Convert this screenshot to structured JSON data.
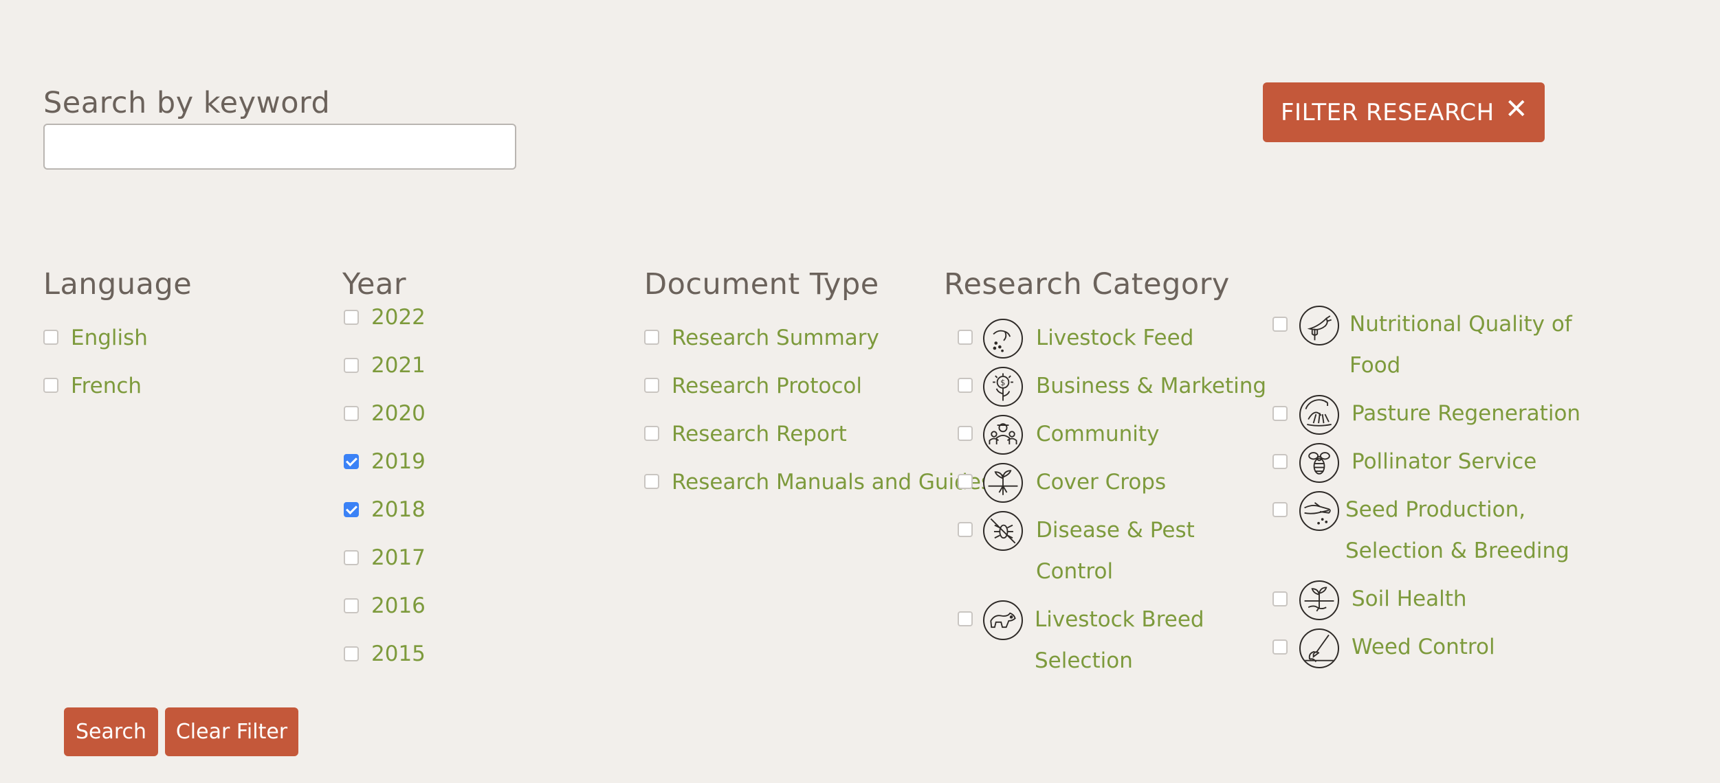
{
  "search": {
    "label": "Search by keyword",
    "value": "",
    "placeholder": ""
  },
  "filter_button": {
    "label": "FILTER RESEARCH",
    "close_symbol": "✕"
  },
  "language": {
    "heading": "Language",
    "options": [
      {
        "label": "English",
        "checked": false
      },
      {
        "label": "French",
        "checked": false
      }
    ]
  },
  "year": {
    "heading": "Year",
    "options": [
      {
        "label": "2022",
        "checked": false
      },
      {
        "label": "2021",
        "checked": false
      },
      {
        "label": "2020",
        "checked": false
      },
      {
        "label": "2019",
        "checked": true
      },
      {
        "label": "2018",
        "checked": true
      },
      {
        "label": "2017",
        "checked": false
      },
      {
        "label": "2016",
        "checked": false
      },
      {
        "label": "2015",
        "checked": false
      }
    ]
  },
  "document_type": {
    "heading": "Document Type",
    "options": [
      {
        "label": "Research Summary",
        "checked": false
      },
      {
        "label": "Research Protocol",
        "checked": false
      },
      {
        "label": "Research Report",
        "checked": false
      },
      {
        "label": "Research Manuals and Guides",
        "checked": false
      }
    ]
  },
  "research_category": {
    "heading": "Research Category",
    "options": [
      {
        "line1": "Livestock Feed",
        "line2": "",
        "icon": "livestock-feed-icon",
        "checked": false
      },
      {
        "line1": "Business & Marketing",
        "line2": "",
        "icon": "business-marketing-icon",
        "checked": false
      },
      {
        "line1": "Community",
        "line2": "",
        "icon": "community-icon",
        "checked": false
      },
      {
        "line1": "Cover Crops",
        "line2": "",
        "icon": "cover-crops-icon",
        "checked": false
      },
      {
        "line1": "Disease & Pest",
        "line2": "Control",
        "icon": "disease-pest-control-icon",
        "checked": false
      },
      {
        "line1": "Livestock Breed",
        "line2": "Selection",
        "icon": "livestock-breed-selection-icon",
        "checked": false
      },
      {
        "line1": "Nutritional Quality of",
        "line2": "Food",
        "icon": "nutritional-quality-icon",
        "checked": false
      },
      {
        "line1": "Pasture Regeneration",
        "line2": "",
        "icon": "pasture-regeneration-icon",
        "checked": false
      },
      {
        "line1": "Pollinator Service",
        "line2": "",
        "icon": "pollinator-service-icon",
        "checked": false
      },
      {
        "line1": "Seed Production,",
        "line2": "Selection & Breeding",
        "icon": "seed-production-icon",
        "checked": false
      },
      {
        "line1": "Soil Health",
        "line2": "",
        "icon": "soil-health-icon",
        "checked": false
      },
      {
        "line1": "Weed Control",
        "line2": "",
        "icon": "weed-control-icon",
        "checked": false
      }
    ]
  },
  "actions": {
    "search_label": "Search",
    "clear_label": "Clear Filter"
  },
  "colors": {
    "background": "#f2efeb",
    "accent": "#c4583a",
    "link_green": "#7d9a3c",
    "heading": "#6b625b",
    "checked": "#3b82f6"
  }
}
